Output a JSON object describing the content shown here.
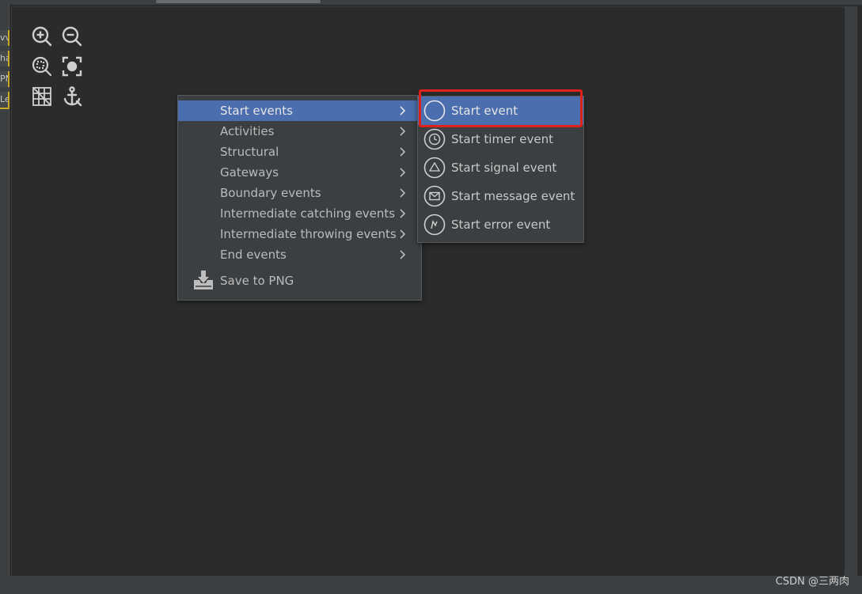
{
  "left_fragments": [
    "vv",
    "ha",
    "PN",
    "Le"
  ],
  "toolbar": {
    "buttons": [
      {
        "name": "zoom-in-icon"
      },
      {
        "name": "zoom-out-icon"
      },
      {
        "name": "zoom-fit-icon"
      },
      {
        "name": "focus-icon"
      },
      {
        "name": "grid-icon"
      },
      {
        "name": "anchor-icon"
      }
    ]
  },
  "context_menu": {
    "items": [
      {
        "label": "Start events",
        "has_submenu": true,
        "active": true
      },
      {
        "label": "Activities",
        "has_submenu": true
      },
      {
        "label": "Structural",
        "has_submenu": true
      },
      {
        "label": "Gateways",
        "has_submenu": true
      },
      {
        "label": "Boundary events",
        "has_submenu": true
      },
      {
        "label": "Intermediate catching events",
        "has_submenu": true
      },
      {
        "label": "Intermediate throwing events",
        "has_submenu": true
      },
      {
        "label": "End events",
        "has_submenu": true
      },
      {
        "label": "Save to PNG",
        "icon": "save-download-icon"
      }
    ]
  },
  "submenu": {
    "items": [
      {
        "label": "Start event",
        "icon": "start-event-circle-icon",
        "active": true
      },
      {
        "label": "Start timer event",
        "icon": "timer-icon"
      },
      {
        "label": "Start signal event",
        "icon": "signal-triangle-icon"
      },
      {
        "label": "Start message event",
        "icon": "message-envelope-icon"
      },
      {
        "label": "Start error event",
        "icon": "error-lightning-icon"
      }
    ]
  },
  "colors": {
    "background": "#2b2b2b",
    "menu_bg": "#3c3f41",
    "selection": "#4b6eaf",
    "highlight_border": "#e0201b"
  },
  "watermark": "CSDN @三两肉"
}
